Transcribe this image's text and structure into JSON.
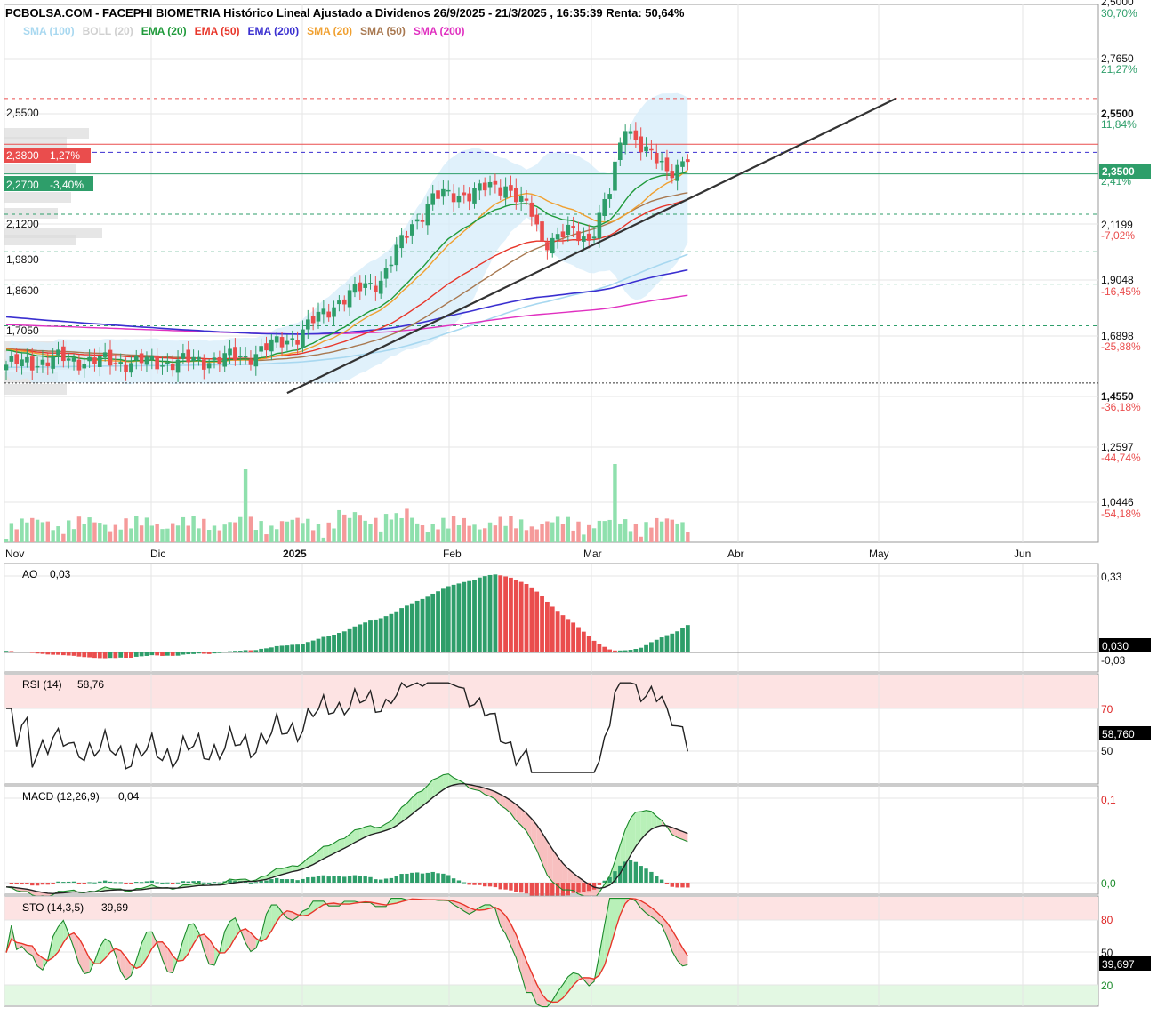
{
  "title": "PCBOLSA.COM - FACEPHI BIOMETRIA Histórico Lineal Ajustado a Dividenos 26/9/2025 - 21/3/2025 , 16:35:39 Renta: 50,64%",
  "legend": [
    {
      "label": "SMA (100)",
      "color": "#a8d8f0"
    },
    {
      "label": "BOLL (20)",
      "color": "#d0d0d0"
    },
    {
      "label": "EMA (20)",
      "color": "#1f9a3a"
    },
    {
      "label": "EMA (50)",
      "color": "#e8362a"
    },
    {
      "label": "EMA (200)",
      "color": "#3a2fd0"
    },
    {
      "label": "SMA (20)",
      "color": "#f0a030"
    },
    {
      "label": "SMA (50)",
      "color": "#a87850"
    },
    {
      "label": "SMA (200)",
      "color": "#e030c0"
    }
  ],
  "colors": {
    "up": "#2e9e6a",
    "down": "#ea4d4d",
    "volume_up": "#8fe0ad",
    "volume_down": "#f59a9a"
  },
  "price_axis": [
    {
      "value": "2,5000",
      "pct": "30,70%",
      "pct_color": "#2e9e6a"
    },
    {
      "value": "2,7650",
      "pct": "21,27%",
      "pct_color": "#2e9e6a"
    },
    {
      "value": "2,5500",
      "pct": "11,84%",
      "pct_color": "#2e9e6a"
    },
    {
      "value": "2,1199",
      "pct": "-7,02%",
      "pct_color": "#ea4d4d"
    },
    {
      "value": "1,9048",
      "pct": "-16,45%",
      "pct_color": "#ea4d4d"
    },
    {
      "value": "1,6898",
      "pct": "-25,88%",
      "pct_color": "#ea4d4d"
    },
    {
      "value": "1,4550",
      "pct": "-36,18%",
      "pct_color": "#ea4d4d"
    },
    {
      "value": "1,2597",
      "pct": "-44,74%",
      "pct_color": "#ea4d4d"
    },
    {
      "value": "1,0446",
      "pct": "-54,18%",
      "pct_color": "#ea4d4d"
    }
  ],
  "current_price": {
    "value": "2,3500",
    "pct": "2,41%"
  },
  "levels_left": [
    {
      "label": "2,5500"
    },
    {
      "label": "2,1200"
    },
    {
      "label": "1,9800"
    },
    {
      "label": "1,8600"
    },
    {
      "label": "1,7050"
    }
  ],
  "resistance_tag": {
    "label": "2,3800",
    "pct": "1,27%"
  },
  "support_tag": {
    "label": "2,2700",
    "pct": "-3,40%"
  },
  "months": [
    "Nov",
    "Dic",
    "2025",
    "Feb",
    "Mar",
    "Abr",
    "May",
    "Jun"
  ],
  "indicators": {
    "ao": {
      "label": "AO",
      "value": "0,03",
      "axis": [
        "0,33",
        "-0,03"
      ],
      "tag": "0,030"
    },
    "rsi": {
      "label": "RSI (14)",
      "value": "58,76",
      "axis": [
        "70",
        "50"
      ],
      "tag": "58,760"
    },
    "macd": {
      "label": "MACD (12,26,9)",
      "value": "0,04",
      "axis": [
        "0,1",
        "0,0"
      ]
    },
    "sto": {
      "label": "STO (14,3,5)",
      "value": "39,69",
      "axis": [
        "80",
        "50",
        "20"
      ],
      "tag": "39,697"
    }
  },
  "chart_data": {
    "type": "candlestick",
    "instrument": "FACEPHI BIOMETRIA",
    "period": "26/9/2025 - 21/3/2025",
    "ylim": [
      0.9,
      2.9
    ],
    "x_months": [
      "Nov",
      "Dic",
      "2025",
      "Feb",
      "Mar",
      "Abr",
      "May",
      "Jun"
    ],
    "close_anchors": [
      [
        0,
        1.56
      ],
      [
        10,
        1.58
      ],
      [
        22,
        1.57
      ],
      [
        33,
        1.57
      ],
      [
        46,
        1.59
      ],
      [
        56,
        1.67
      ],
      [
        64,
        1.8
      ],
      [
        72,
        1.88
      ],
      [
        78,
        2.08
      ],
      [
        82,
        2.18
      ],
      [
        89,
        2.2
      ],
      [
        96,
        2.23
      ],
      [
        101,
        2.12
      ],
      [
        103,
        2.02
      ],
      [
        108,
        2.05
      ],
      [
        112,
        2.03
      ],
      [
        116,
        2.2
      ],
      [
        119,
        2.46
      ],
      [
        123,
        2.35
      ],
      [
        127,
        2.28
      ],
      [
        131,
        2.33
      ]
    ],
    "volume_spikes": [
      {
        "x_index": 46,
        "level": "high"
      },
      {
        "x_index": 117,
        "level": "highest"
      }
    ],
    "horizontal_levels": [
      2.55,
      2.38,
      2.35,
      2.27,
      2.12,
      1.98,
      1.86,
      1.705,
      1.4923
    ],
    "trendline": {
      "from": {
        "x_index": 54,
        "price": 1.455
      },
      "to": {
        "x_index": 171,
        "price": 2.55
      }
    },
    "indicators": {
      "AO": 0.03,
      "RSI_14": 58.76,
      "MACD_12_26_9": 0.04,
      "STO_14_3_5": 39.69
    }
  }
}
